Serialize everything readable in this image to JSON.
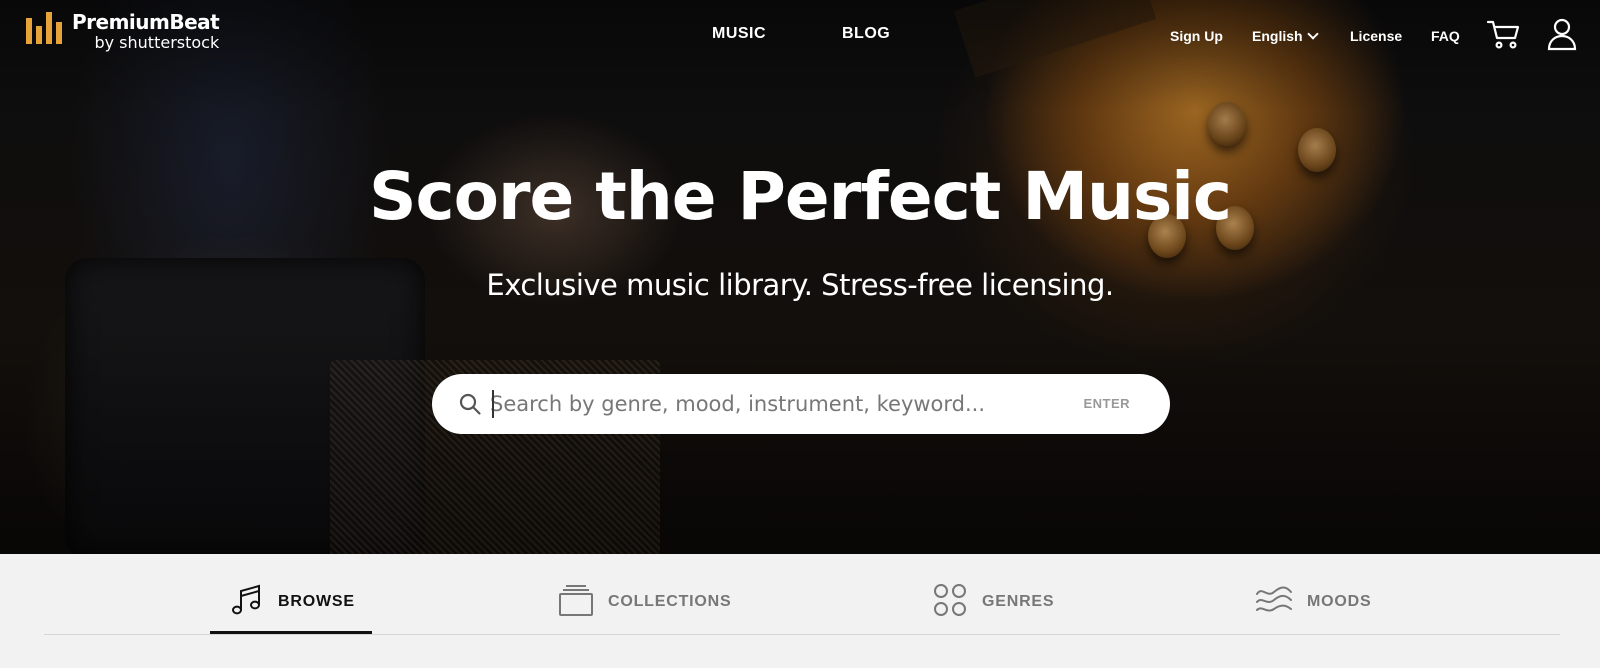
{
  "brand": {
    "name": "PremiumBeat",
    "sub": "by shutterstock",
    "accent": "#e6a33a"
  },
  "nav": {
    "main": [
      {
        "label": "MUSIC"
      },
      {
        "label": "BLOG"
      }
    ],
    "right": {
      "signup": "Sign Up",
      "language": "English",
      "license": "License",
      "faq": "FAQ"
    },
    "icons": [
      "cart-icon",
      "user-icon"
    ]
  },
  "hero": {
    "title": "Score the Perfect Music",
    "subtitle": "Exclusive music library. Stress-free licensing."
  },
  "search": {
    "placeholder": "Search by genre, mood, instrument, keyword...",
    "value": "",
    "enter_label": "ENTER",
    "icon": "search-icon"
  },
  "tabs": [
    {
      "label": "BROWSE",
      "icon": "music-note-icon",
      "active": true
    },
    {
      "label": "COLLECTIONS",
      "icon": "collections-icon",
      "active": false
    },
    {
      "label": "GENRES",
      "icon": "genres-icon",
      "active": false
    },
    {
      "label": "MOODS",
      "icon": "moods-icon",
      "active": false
    }
  ]
}
